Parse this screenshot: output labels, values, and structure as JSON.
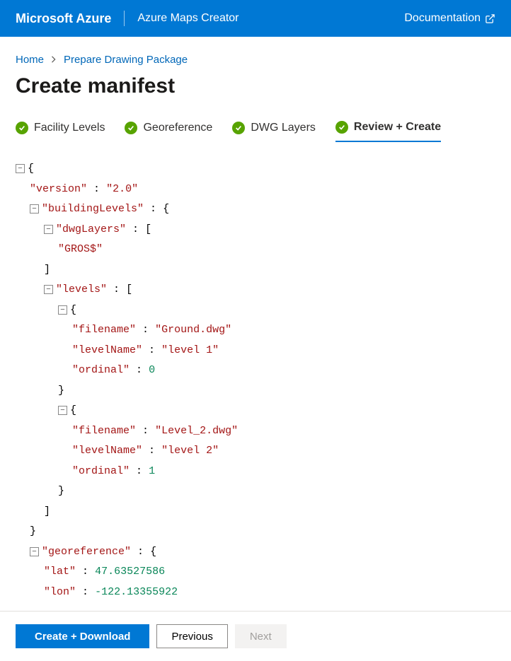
{
  "topbar": {
    "brand": "Microsoft Azure",
    "title": "Azure Maps Creator",
    "docLink": "Documentation"
  },
  "breadcrumb": {
    "home": "Home",
    "prepare": "Prepare Drawing Package"
  },
  "page": {
    "title": "Create manifest"
  },
  "steps": {
    "s0": "Facility Levels",
    "s1": "Georeference",
    "s2": "DWG Layers",
    "s3": "Review + Create"
  },
  "manifest": {
    "versionKey": "\"version\"",
    "versionVal": "\"2.0\"",
    "buildingLevelsKey": "\"buildingLevels\"",
    "dwgLayersKey": "\"dwgLayers\"",
    "dwgLayersVal0": "\"GROS$\"",
    "levelsKey": "\"levels\"",
    "filenameKey": "\"filename\"",
    "levelNameKey": "\"levelName\"",
    "ordinalKey": "\"ordinal\"",
    "lvl0_filename": "\"Ground.dwg\"",
    "lvl0_levelName": "\"level 1\"",
    "lvl0_ordinal": "0",
    "lvl1_filename": "\"Level_2.dwg\"",
    "lvl1_levelName": "\"level 2\"",
    "lvl1_ordinal": "1",
    "georefKey": "\"georeference\"",
    "latKey": "\"lat\"",
    "latVal": "47.63527586",
    "lonKey": "\"lon\"",
    "lonVal": "-122.13355922"
  },
  "footer": {
    "primary": "Create + Download",
    "prev": "Previous",
    "next": "Next"
  }
}
